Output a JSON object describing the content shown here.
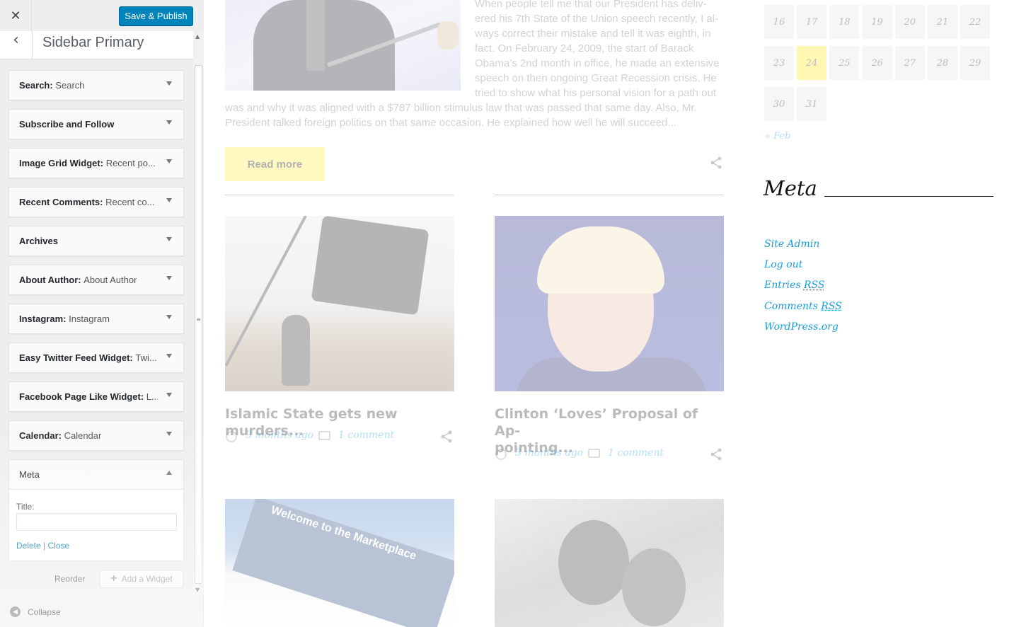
{
  "customizer": {
    "close_glyph": "✕",
    "publish_label": "Save & Publish",
    "back_glyph": "‹",
    "section_title": "Sidebar Primary",
    "widgets": [
      {
        "name": "Search",
        "sub": "Search"
      },
      {
        "name": "Subscribe and Follow",
        "sub": ""
      },
      {
        "name": "Image Grid Widget",
        "sub": "Recent po..."
      },
      {
        "name": "Recent Comments",
        "sub": "Recent co..."
      },
      {
        "name": "Archives",
        "sub": ""
      },
      {
        "name": "About Author",
        "sub": "About Author"
      },
      {
        "name": "Instagram",
        "sub": "Instagram"
      },
      {
        "name": "Easy Twitter Feed Widget",
        "sub": "Twi..."
      },
      {
        "name": "Facebook Page Like Widget",
        "sub": "L..."
      },
      {
        "name": "Calendar",
        "sub": "Calendar"
      }
    ],
    "meta_widget": {
      "name": "Meta",
      "title_label": "Title:",
      "title_value": "",
      "delete_label": "Delete",
      "separator": "|",
      "close_label": "Close"
    },
    "reorder_label": "Reorder",
    "add_widget_label": "Add a Widget",
    "collapse_label": "Collapse"
  },
  "preview": {
    "hero_text_lines": [
      "When people tell me that our President has deliv-",
      "ered his 7th State of the Union speech recently, I al-",
      "ways correct their mistake and tell it was eighth, in",
      "fact. On February 24, 2009, the start of Barack",
      "Obama’s 2nd month in office, he made an extensive",
      "speech on then ongoing Great Recession crisis. He",
      "tried to show what his personal vision for a path out",
      "was and why it was aligned with a $787 billion stimulus law that was passed that same day. Also, Mr.",
      "President talked foreign politics on that same occasion. He explained how well he will succeed..."
    ],
    "read_more_label": "Read more",
    "posts": [
      {
        "title_lines": [
          "Islamic State gets new murders..."
        ],
        "time": "3 months ago",
        "comments": "1 comment"
      },
      {
        "title_lines": [
          "Clinton ‘Loves’ Proposal of Ap-",
          "pointing..."
        ],
        "time": "3 months ago",
        "comments": "1 comment"
      }
    ],
    "market_image_text": "Welcome to the Marketplace",
    "calendar": {
      "rows": [
        [
          "16",
          "17",
          "18",
          "19",
          "20",
          "21",
          "22"
        ],
        [
          "23",
          "24",
          "25",
          "26",
          "27",
          "28",
          "29"
        ],
        [
          "30",
          "31"
        ]
      ],
      "today": "24",
      "prev_label": "« Feb"
    },
    "meta": {
      "heading": "Meta",
      "links": [
        {
          "text": "Site Admin",
          "abbr": ""
        },
        {
          "text": "Log out",
          "abbr": ""
        },
        {
          "text": "Entries",
          "abbr": "RSS"
        },
        {
          "text": "Comments",
          "abbr": "RSS"
        },
        {
          "text": "WordPress.org",
          "abbr": ""
        }
      ]
    }
  }
}
